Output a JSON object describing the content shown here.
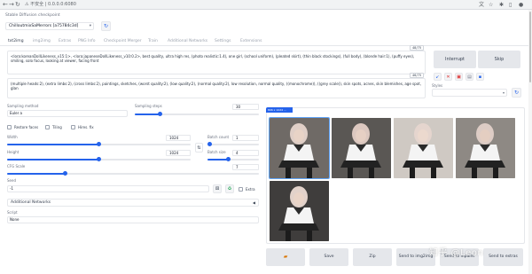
{
  "browser": {
    "insecure_label": "不安全",
    "url": "0.0.0.0:6080"
  },
  "checkpoint": {
    "label": "Stable Diffusion checkpoint",
    "value": "ChilloutmixSaMerrors [a75784c3d]"
  },
  "tabs": [
    "txt2img",
    "img2img",
    "Extras",
    "PNG Info",
    "Checkpoint Merger",
    "Train",
    "Additional Networks",
    "Settings",
    "Extensions"
  ],
  "prompt": {
    "text": "<lora:koreanDollLikeness_v15:1>, <lora:japaneseDollLikeness_v10:0.2>, best quality, ultra high res, (photo realistic:1.4), one girl, (school uniform), (pleated skirt), (thin black stockings), (full body), (blonde hair:1), (puffy eyes), smiling, solo focus, looking at viewer, facing front",
    "counter": "48/75"
  },
  "negative": {
    "text": "(multiple heads:2), (extra limbs:2), (cross limbs:2), paintings, sketches, (worst quality:2), (low quality:2), (normal quality:2), low resolution, normal quality, ((monochrome)), ((grey scale)), skin spots, acnes, skin blemishes, age spot, glan",
    "counter": "46/75"
  },
  "actions": {
    "interrupt": "Interrupt",
    "skip": "Skip",
    "styles_label": "Styles"
  },
  "tools": [
    {
      "icon": "arrow-down-icon",
      "glyph": "↙",
      "color": "#2563eb"
    },
    {
      "icon": "trash-icon",
      "glyph": "✕",
      "color": "#dc2626"
    },
    {
      "icon": "card-icon",
      "glyph": "▣",
      "color": "#dc2626"
    },
    {
      "icon": "clipboard-icon",
      "glyph": "▤",
      "color": "#6b7280"
    },
    {
      "icon": "save-icon",
      "glyph": "▪",
      "color": "#2563eb"
    }
  ],
  "params": {
    "sampling_method_label": "Sampling method",
    "sampling_method": "Euler a",
    "sampling_steps_label": "Sampling steps",
    "sampling_steps": "30",
    "sampling_steps_pct": 0.2,
    "restore_faces": "Restore faces",
    "tiling": "Tiling",
    "hires_fix": "Hires. fix",
    "width_label": "Width",
    "width": "1024",
    "width_pct": 0.5,
    "height_label": "Height",
    "height": "1024",
    "height_pct": 0.5,
    "batch_count_label": "Batch count",
    "batch_count": "1",
    "batch_count_pct": 0.0,
    "batch_size_label": "Batch size",
    "batch_size": "4",
    "batch_size_pct": 0.4,
    "cfg_label": "CFG Scale",
    "cfg": "7",
    "cfg_pct": 0.23,
    "seed_label": "Seed",
    "seed": "-1",
    "extra": "Extra",
    "additional_networks": "Additional Networks",
    "script_label": "Script",
    "script": "None"
  },
  "gallery": {
    "header": "896 x 1024 ...",
    "thumbs": [
      {
        "bg": "#6f6a66",
        "skin": "#e8d3c6",
        "hair": "#e0cfc7"
      },
      {
        "bg": "#5a5754",
        "skin": "#e6d0c4",
        "hair": "#dcc8c0"
      },
      {
        "bg": "#cfc9c3",
        "skin": "#ecd9ce",
        "hair": "#e5d5ce"
      },
      {
        "bg": "#8e8984",
        "skin": "#e4cec1",
        "hair": "#ddccc5"
      },
      {
        "bg": "#3f3d3c",
        "skin": "#e9d4c7",
        "hair": "#e2d2ca"
      }
    ]
  },
  "bottom_buttons": [
    "",
    "Save",
    "Zip",
    "Send to img2img",
    "Send to inpaint",
    "Send to extras"
  ],
  "watermark": "知乎 @Leon"
}
